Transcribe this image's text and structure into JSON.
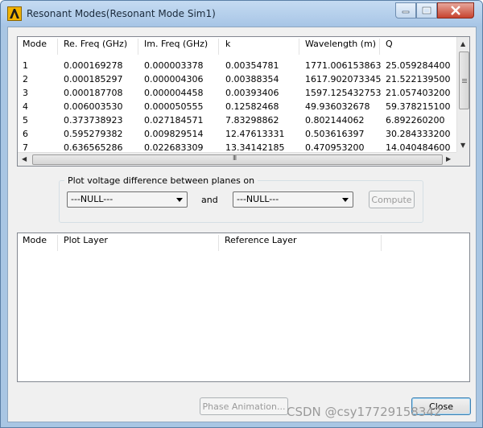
{
  "window": {
    "title": "Resonant Modes(Resonant Mode Sim1)"
  },
  "modes_table": {
    "columns": [
      "Mode",
      "Re. Freq (GHz)",
      "Im. Freq (GHz)",
      "k",
      "Wavelength (m)",
      "Q"
    ],
    "rows": [
      [
        "1",
        "0.000169278",
        "0.000003378",
        "0.00354781",
        "1771.006153863",
        "25.059284400"
      ],
      [
        "2",
        "0.000185297",
        "0.000004306",
        "0.00388354",
        "1617.902073345",
        "21.522139500"
      ],
      [
        "3",
        "0.000187708",
        "0.000004458",
        "0.00393406",
        "1597.125432753",
        "21.057403200"
      ],
      [
        "4",
        "0.006003530",
        "0.000050555",
        "0.12582468",
        "49.936032678",
        "59.378215100"
      ],
      [
        "5",
        "0.373738923",
        "0.027184571",
        "7.83298862",
        "0.802144062",
        "6.892260200"
      ],
      [
        "6",
        "0.595279382",
        "0.009829514",
        "12.47613331",
        "0.503616397",
        "30.284333200"
      ],
      [
        "7",
        "0.636565286",
        "0.022683309",
        "13.34142185",
        "0.470953200",
        "14.040484600"
      ]
    ]
  },
  "plot_group": {
    "label": "Plot voltage difference between planes on",
    "combo1_value": "---NULL---",
    "and_label": "and",
    "combo2_value": "---NULL---",
    "compute_label": "Compute"
  },
  "layer_table": {
    "columns": [
      "Mode",
      "Plot Layer",
      "Reference Layer"
    ]
  },
  "footer": {
    "phase_animation_label": "Phase Animation...",
    "close_label": "Close"
  },
  "watermark": "CSDN @csy17729158342",
  "scrollbar_grip": "III"
}
